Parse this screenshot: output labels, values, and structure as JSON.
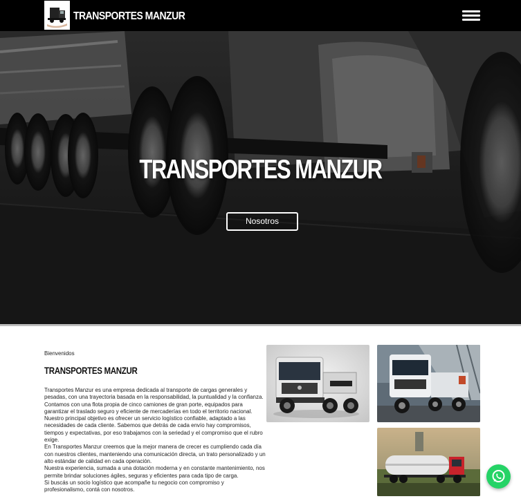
{
  "nav": {
    "brand": "TRANSPORTES MANZUR",
    "menu_icon": "hamburger-menu-icon"
  },
  "hero": {
    "title": "TRANSPORTES MANZUR",
    "button_label": "Nosotros"
  },
  "about": {
    "welcome": "Bienvenidos",
    "title": "TRANSPORTES MANZUR",
    "paragraphs": [
      "Transportes Manzur es una empresa dedicada al transporte de cargas generales y pesadas, con una trayectoria basada en la responsabilidad, la puntualidad y la confianza. Contamos con una flota propia de cinco camiones de gran porte, equipados para garantizar el traslado seguro y eficiente de mercaderías en todo el territorio nacional.",
      "Nuestro principal objetivo es ofrecer un servicio logístico confiable, adaptado a las necesidades de cada cliente. Sabemos que detrás de cada envío hay compromisos, tiempos y expectativas, por eso trabajamos con la seriedad y el compromiso que el rubro exige.",
      "En Transportes Manzur creemos que la mejor manera de crecer es cumpliendo cada día con nuestros clientes, manteniendo una comunicación directa, un trato personalizado y un alto estándar de calidad en cada operación.",
      "Nuestra experiencia, sumada a una dotación moderna y en constante mantenimiento, nos permite brindar soluciones ágiles, seguras y eficientes para cada tipo de carga.",
      "Si buscás un socio logístico que acompañe tu negocio con compromiso y profesionalismo, contá con nosotros."
    ]
  },
  "gallery": {
    "images": [
      "truck-photo-studio",
      "truck-photo-dealership",
      "tanker-truck-photo"
    ]
  },
  "whatsapp": {
    "icon": "whatsapp-icon",
    "color": "#25d366"
  }
}
